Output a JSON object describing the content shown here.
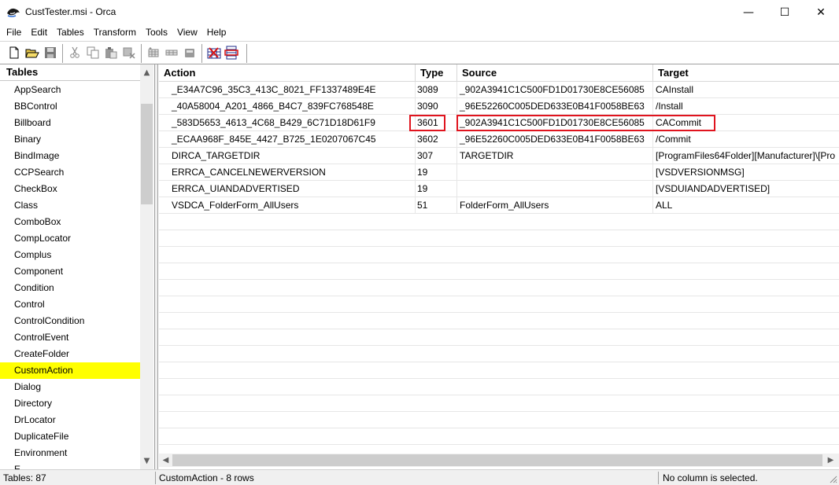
{
  "window": {
    "title": "CustTester.msi - Orca",
    "min_glyph": "—",
    "max_glyph": "☐",
    "close_glyph": "✕"
  },
  "menu": [
    "File",
    "Edit",
    "Tables",
    "Transform",
    "Tools",
    "View",
    "Help"
  ],
  "toolbar": {
    "icons": [
      "new-icon",
      "open-icon",
      "save-icon",
      "cut-icon",
      "copy-icon",
      "paste-icon",
      "delete-icon",
      "add-table-icon",
      "add-row-icon",
      "drop-table-icon",
      "validate-icon",
      "merge-module-icon"
    ]
  },
  "tables_panel": {
    "header": "Tables",
    "items": [
      "AppSearch",
      "BBControl",
      "Billboard",
      "Binary",
      "BindImage",
      "CCPSearch",
      "CheckBox",
      "Class",
      "ComboBox",
      "CompLocator",
      "Complus",
      "Component",
      "Condition",
      "Control",
      "ControlCondition",
      "ControlEvent",
      "CreateFolder",
      "CustomAction",
      "Dialog",
      "Directory",
      "DrLocator",
      "DuplicateFile",
      "Environment",
      "E"
    ],
    "selected": "CustomAction"
  },
  "grid": {
    "columns": [
      "Action",
      "Type",
      "Source",
      "Target"
    ],
    "rows": [
      {
        "action": "_E34A7C96_35C3_413C_8021_FF1337489E4E",
        "type": "3089",
        "source": "_902A3941C1C500FD1D01730E8CE56085",
        "target": "CAInstall"
      },
      {
        "action": "_40A58004_A201_4866_B4C7_839FC768548E",
        "type": "3090",
        "source": "_96E52260C005DED633E0B41F0058BE63",
        "target": "/Install"
      },
      {
        "action": "_583D5653_4613_4C68_B429_6C71D18D61F9",
        "type": "3601",
        "source": "_902A3941C1C500FD1D01730E8CE56085",
        "target": "CACommit"
      },
      {
        "action": "_ECAA968F_845E_4427_B725_1E0207067C45",
        "type": "3602",
        "source": "_96E52260C005DED633E0B41F0058BE63",
        "target": "/Commit"
      },
      {
        "action": "DIRCA_TARGETDIR",
        "type": "307",
        "source": "TARGETDIR",
        "target": "[ProgramFiles64Folder][Manufacturer]\\[Pro"
      },
      {
        "action": "ERRCA_CANCELNEWERVERSION",
        "type": "19",
        "source": "",
        "target": "[VSDVERSIONMSG]"
      },
      {
        "action": "ERRCA_UIANDADVERTISED",
        "type": "19",
        "source": "",
        "target": "[VSDUIANDADVERTISED]"
      },
      {
        "action": "VSDCA_FolderForm_AllUsers",
        "type": "51",
        "source": "FolderForm_AllUsers",
        "target": "ALL"
      }
    ],
    "highlight_color": "#e0141e"
  },
  "status": {
    "tables": "Tables: 87",
    "rows": "CustomAction - 8 rows",
    "column": "No column is selected."
  },
  "colors": {
    "selected_table": "#ffff00",
    "highlight": "#e0141e"
  }
}
